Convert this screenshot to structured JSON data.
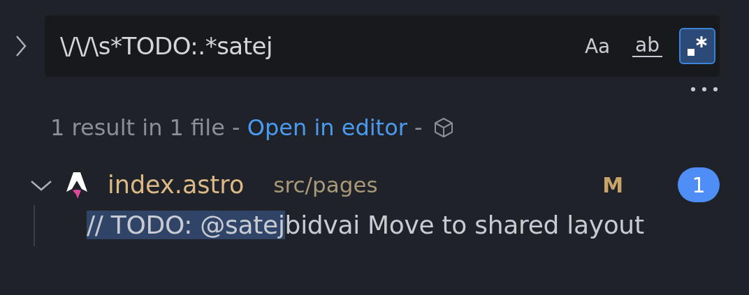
{
  "search": {
    "expanded": false,
    "value": "\\/\\/\\s*TODO:.*satej",
    "toggles": [
      {
        "kind": "case",
        "label": "Aa",
        "selected": false
      },
      {
        "kind": "word",
        "label": "ab",
        "selected": false
      },
      {
        "kind": "regex",
        "selected": true
      }
    ]
  },
  "summary": {
    "text": "1 result in 1 file -",
    "link": "Open in editor",
    "after": "-"
  },
  "results": [
    {
      "file": "index.astro",
      "path": "src/pages",
      "status": "M",
      "count": "1",
      "expanded": true,
      "matches": [
        {
          "match": "// TODO: @satej",
          "after": "bidvai Move to shared layout"
        }
      ]
    }
  ]
}
